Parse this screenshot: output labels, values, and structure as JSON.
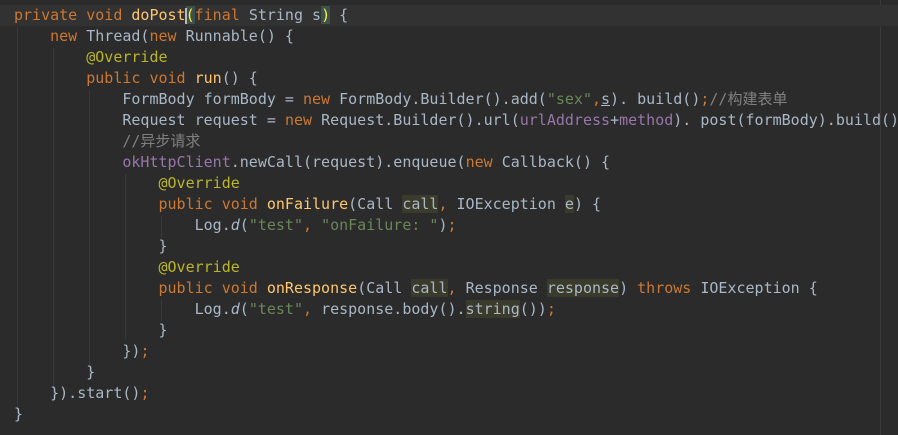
{
  "editor": {
    "lines": [
      [
        [
          "kw",
          "private void "
        ],
        [
          "fn",
          "doPost"
        ],
        [
          "bm",
          "("
        ],
        [
          "kw",
          "final "
        ],
        [
          "",
          "String s"
        ],
        [
          "bm",
          ")"
        ],
        [
          "",
          " {"
        ]
      ],
      [
        [
          "",
          "    "
        ],
        [
          "kw",
          "new "
        ],
        [
          "",
          "Thread("
        ],
        [
          "kw",
          "new "
        ],
        [
          "",
          "Runnable() {"
        ]
      ],
      [
        [
          "",
          "        "
        ],
        [
          "ann",
          "@Override"
        ]
      ],
      [
        [
          "",
          "        "
        ],
        [
          "kw",
          "public void "
        ],
        [
          "fn",
          "run"
        ],
        [
          "",
          "() {"
        ]
      ],
      [
        [
          "",
          "            FormBody formBody = "
        ],
        [
          "kw",
          "new "
        ],
        [
          "",
          "FormBody.Builder().add("
        ],
        [
          "str",
          "\"sex\""
        ],
        [
          "kw",
          ","
        ],
        [
          "ul",
          "s"
        ],
        [
          "",
          "). build()"
        ],
        [
          "kw",
          ";"
        ],
        [
          "cmt",
          "//构建表单"
        ]
      ],
      [
        [
          "",
          "            Request request = "
        ],
        [
          "kw",
          "new "
        ],
        [
          "",
          "Request.Builder().url("
        ],
        [
          "fld",
          "urlAddress"
        ],
        [
          "",
          "+"
        ],
        [
          "fld",
          "method"
        ],
        [
          "",
          "). post(formBody).build()"
        ],
        [
          "kw",
          ";"
        ]
      ],
      [
        [
          "",
          "            "
        ],
        [
          "cmt",
          "//异步请求"
        ]
      ],
      [
        [
          "",
          "            "
        ],
        [
          "fld",
          "okHttpClient"
        ],
        [
          "",
          ".newCall(request).enqueue("
        ],
        [
          "kw",
          "new "
        ],
        [
          "",
          "Callback() {"
        ]
      ],
      [
        [
          "",
          "                "
        ],
        [
          "ann",
          "@Override"
        ]
      ],
      [
        [
          "",
          "                "
        ],
        [
          "kw",
          "public void "
        ],
        [
          "fn",
          "onFailure"
        ],
        [
          "",
          "(Call "
        ],
        [
          "hl",
          "call"
        ],
        [
          "kw",
          ", "
        ],
        [
          "",
          "IOException "
        ],
        [
          "hl",
          "e"
        ],
        [
          "",
          ") {"
        ]
      ],
      [
        [
          "",
          "                    Log."
        ],
        [
          "it",
          "d"
        ],
        [
          "",
          "("
        ],
        [
          "str",
          "\"test\""
        ],
        [
          "kw",
          ", "
        ],
        [
          "str",
          "\"onFailure: \""
        ],
        [
          "",
          ")"
        ],
        [
          "kw",
          ";"
        ]
      ],
      [
        [
          "",
          "                }"
        ]
      ],
      [
        [
          "",
          "                "
        ],
        [
          "ann",
          "@Override"
        ]
      ],
      [
        [
          "",
          "                "
        ],
        [
          "kw",
          "public void "
        ],
        [
          "fn",
          "onResponse"
        ],
        [
          "",
          "(Call "
        ],
        [
          "hl",
          "call"
        ],
        [
          "kw",
          ", "
        ],
        [
          "",
          "Response "
        ],
        [
          "hl",
          "response"
        ],
        [
          "",
          ") "
        ],
        [
          "kw",
          "throws "
        ],
        [
          "",
          "IOException {"
        ]
      ],
      [
        [
          "",
          "                    Log."
        ],
        [
          "it",
          "d"
        ],
        [
          "",
          "("
        ],
        [
          "str",
          "\"test\""
        ],
        [
          "kw",
          ", "
        ],
        [
          "",
          "response.body()."
        ],
        [
          "hl",
          "string"
        ],
        [
          "",
          "())"
        ],
        [
          "kw",
          ";"
        ]
      ],
      [
        [
          "",
          "                }"
        ]
      ],
      [
        [
          "",
          "            })"
        ],
        [
          "kw",
          ";"
        ]
      ],
      [
        [
          "",
          "        }"
        ]
      ],
      [
        [
          "",
          "    }).start()"
        ],
        [
          "kw",
          ";"
        ]
      ],
      [
        [
          "",
          "}"
        ]
      ]
    ]
  }
}
